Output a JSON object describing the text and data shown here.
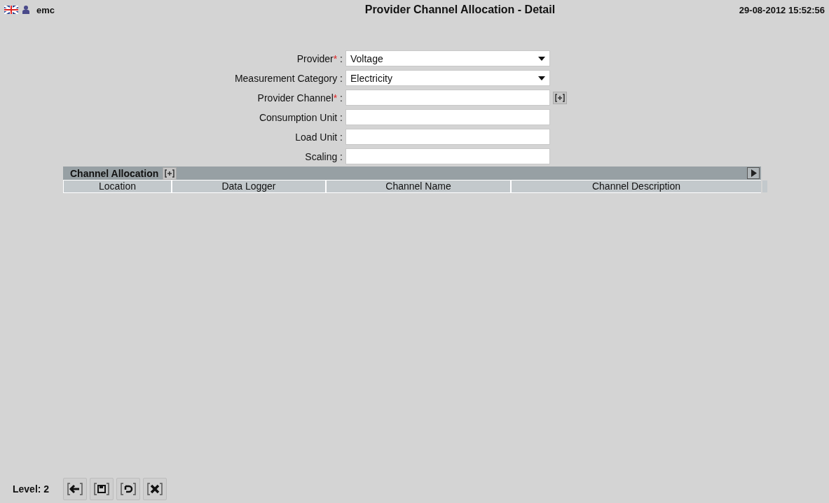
{
  "header": {
    "user": "emc",
    "title": "Provider Channel Allocation - Detail",
    "datetime": "29-08-2012 15:52:56"
  },
  "form": [
    {
      "label": "Provider",
      "required_mark": "*",
      "separator": ":",
      "kind": "select",
      "value": "Voltage"
    },
    {
      "label": "Measurement Category",
      "separator": ":",
      "kind": "select",
      "value": "Electricity"
    },
    {
      "label": "Provider Channel",
      "required_mark": "*",
      "separator": ":",
      "kind": "text",
      "add_button": true
    },
    {
      "label": "Consumption Unit",
      "separator": ":",
      "kind": "text"
    },
    {
      "label": "Load Unit",
      "separator": ":",
      "kind": "text"
    },
    {
      "label": "Scaling",
      "separator": ":",
      "kind": "text"
    }
  ],
  "section": {
    "title": "Channel Allocation",
    "columns": [
      "Location",
      "Data Logger",
      "Channel Name",
      "Channel Description"
    ]
  },
  "footer": {
    "level": "Level: 2",
    "buttons": [
      {
        "kind": "back"
      },
      {
        "kind": "save"
      },
      {
        "kind": "undo"
      },
      {
        "kind": "close"
      }
    ]
  }
}
